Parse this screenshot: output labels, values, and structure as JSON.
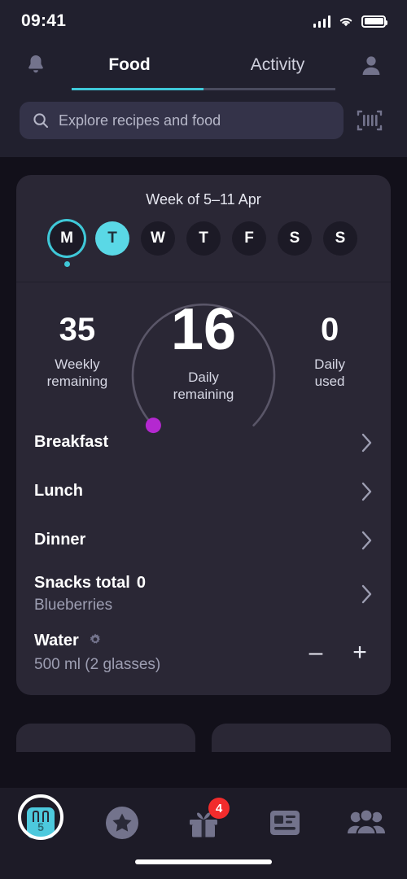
{
  "status_bar": {
    "time": "09:41",
    "signal_icon": "cellular-signal-icon",
    "wifi_icon": "wifi-icon",
    "battery_icon": "battery-icon"
  },
  "header": {
    "notifications_icon": "bell-icon",
    "profile_icon": "user-avatar-icon",
    "tabs": [
      {
        "label": "Food",
        "active": true
      },
      {
        "label": "Activity",
        "active": false
      }
    ]
  },
  "search": {
    "placeholder": "Explore recipes and food",
    "value": "",
    "search_icon": "search-icon",
    "scan_icon": "barcode-scan-icon"
  },
  "week": {
    "title": "Week of 5–11 Apr",
    "days": [
      {
        "letter": "M",
        "today": true,
        "selected": false,
        "dot": true
      },
      {
        "letter": "T",
        "today": false,
        "selected": true,
        "dot": false
      },
      {
        "letter": "W",
        "today": false,
        "selected": false,
        "dot": false
      },
      {
        "letter": "T",
        "today": false,
        "selected": false,
        "dot": false
      },
      {
        "letter": "F",
        "today": false,
        "selected": false,
        "dot": false
      },
      {
        "letter": "S",
        "today": false,
        "selected": false,
        "dot": false
      },
      {
        "letter": "S",
        "today": false,
        "selected": false,
        "dot": false
      }
    ]
  },
  "stats": {
    "weekly_remaining": {
      "value": "35",
      "label_line1": "Weekly",
      "label_line2": "remaining"
    },
    "daily_remaining": {
      "value": "16",
      "label_line1": "Daily",
      "label_line2": "remaining"
    },
    "daily_used": {
      "value": "0",
      "label_line1": "Daily",
      "label_line2": "used"
    },
    "ring_track_color": "#5a5668",
    "ring_marker_color": "#b428d0"
  },
  "meals": [
    {
      "title": "Breakfast",
      "sub": "",
      "count": ""
    },
    {
      "title": "Lunch",
      "sub": "",
      "count": ""
    },
    {
      "title": "Dinner",
      "sub": "",
      "count": ""
    }
  ],
  "snacks": {
    "title": "Snacks total",
    "count": "0",
    "sub": "Blueberries",
    "chevron_icon": "chevron-right-icon"
  },
  "water": {
    "title": "Water",
    "sub": "500 ml (2 glasses)",
    "settings_icon": "gear-icon",
    "minus_label": "–",
    "plus_label": "+"
  },
  "bottom_nav": [
    {
      "icon": "shopping-bag-icon",
      "active": true,
      "badge": ""
    },
    {
      "icon": "star-circle-icon",
      "active": false,
      "badge": ""
    },
    {
      "icon": "gift-icon",
      "active": false,
      "badge": "4"
    },
    {
      "icon": "news-article-icon",
      "active": false,
      "badge": ""
    },
    {
      "icon": "community-people-icon",
      "active": false,
      "badge": ""
    }
  ],
  "colors": {
    "accent": "#3fc8d8",
    "accent_bright": "#5ad8e6",
    "badge": "#f22c2c",
    "marker": "#b428d0"
  }
}
